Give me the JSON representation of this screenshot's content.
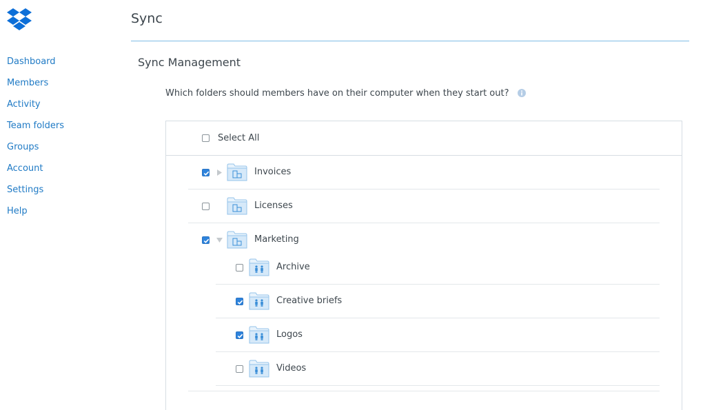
{
  "header": {
    "title": "Sync"
  },
  "sidebar": {
    "items": [
      {
        "label": "Dashboard"
      },
      {
        "label": "Members"
      },
      {
        "label": "Activity"
      },
      {
        "label": "Team folders"
      },
      {
        "label": "Groups"
      },
      {
        "label": "Account"
      },
      {
        "label": "Settings"
      },
      {
        "label": "Help"
      }
    ]
  },
  "main": {
    "section_title": "Sync Management",
    "question": "Which folders should members have on their computer when they start out?",
    "select_all": {
      "label": "Select All",
      "checked": false
    },
    "folders": [
      {
        "label": "Invoices",
        "checked": true,
        "expander": "collapsed",
        "icon": "team-folder-icon"
      },
      {
        "label": "Licenses",
        "checked": false,
        "expander": "none",
        "icon": "team-folder-icon"
      },
      {
        "label": "Marketing",
        "checked": true,
        "expander": "expanded",
        "icon": "team-folder-icon",
        "children": [
          {
            "label": "Archive",
            "checked": false,
            "icon": "shared-folder-icon"
          },
          {
            "label": "Creative briefs",
            "checked": true,
            "icon": "shared-folder-icon"
          },
          {
            "label": "Logos",
            "checked": true,
            "icon": "shared-folder-icon"
          },
          {
            "label": "Videos",
            "checked": false,
            "icon": "shared-folder-icon"
          }
        ]
      }
    ]
  },
  "colors": {
    "link": "#1f7ac5",
    "accent": "#2e83dc",
    "folder": "#a9d2f3",
    "rule": "#7fbce6"
  }
}
